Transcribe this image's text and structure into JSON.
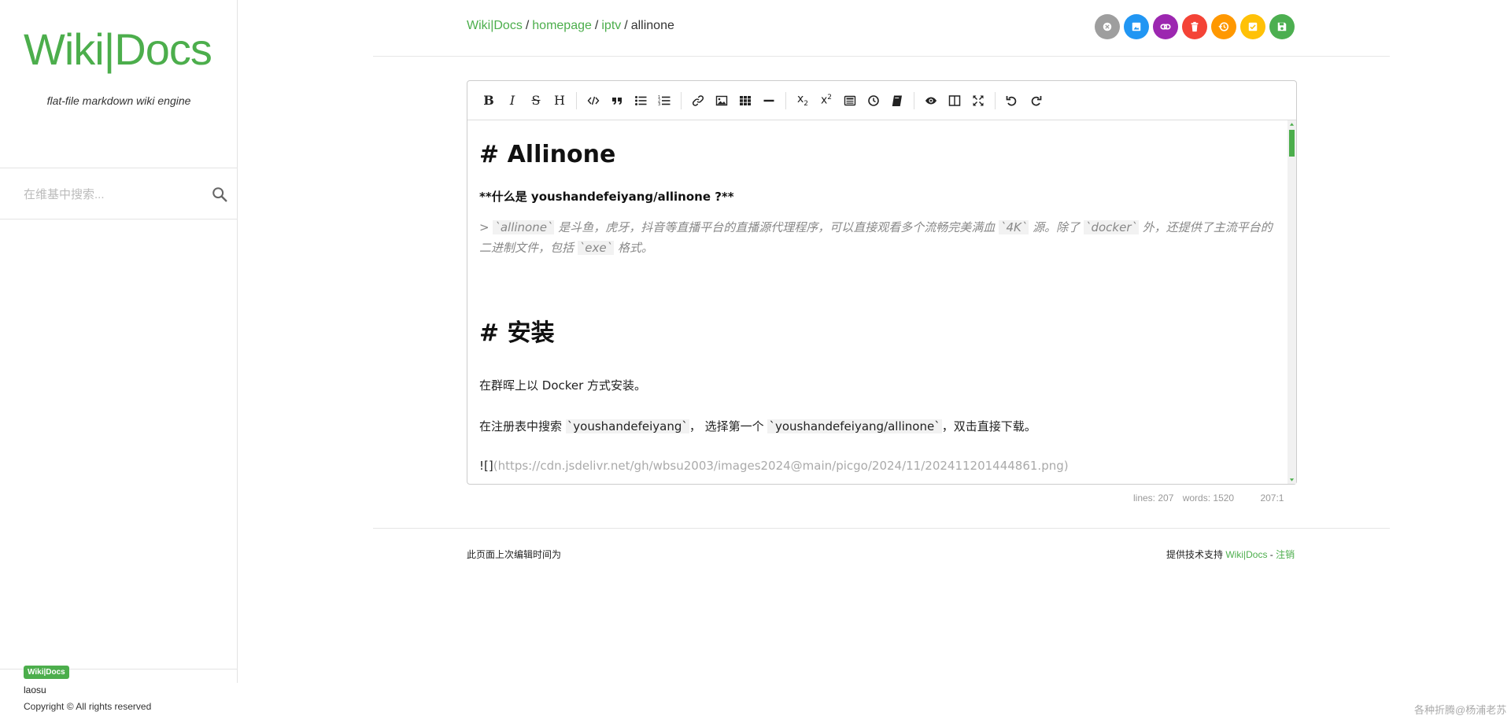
{
  "sidebar": {
    "logo": "Wiki|Docs",
    "tagline": "flat-file markdown wiki engine",
    "search_placeholder": "在维基中搜索...",
    "badge": "Wiki|Docs",
    "user": "laosu",
    "copyright": "Copyright © All rights reserved"
  },
  "breadcrumb": {
    "items": [
      "Wiki|Docs",
      "homepage",
      "iptv"
    ],
    "separator": "/",
    "current": "allinone"
  },
  "actions": [
    {
      "name": "close",
      "color": "#9e9e9e",
      "icon": "close-icon"
    },
    {
      "name": "image",
      "color": "#2196f3",
      "icon": "image-icon"
    },
    {
      "name": "link",
      "color": "#9c27b0",
      "icon": "link-icon"
    },
    {
      "name": "delete",
      "color": "#f44336",
      "icon": "trash-icon"
    },
    {
      "name": "history",
      "color": "#ff9800",
      "icon": "history-icon"
    },
    {
      "name": "checklist",
      "color": "#ffc107",
      "icon": "check-square-icon"
    },
    {
      "name": "save",
      "color": "#4caf50",
      "icon": "save-icon"
    }
  ],
  "editor": {
    "h1_a": "# Allinone",
    "bold_line": "**什么是 youshandefeiyang/allinone ?**",
    "quote": {
      "p1": "> ",
      "c1": "`allinone`",
      "p2": " 是斗鱼，虎牙，抖音等直播平台的直播源代理程序，可以直接观看多个流畅完美满血 ",
      "c2": "`4K`",
      "p3": " 源。除了 ",
      "c3": "`docker`",
      "p4": " 外，还提供了主流平台的二进制文件，包括 ",
      "c4": "`exe`",
      "p5": " 格式。"
    },
    "h1_b": "# 安装",
    "line1": "在群晖上以 Docker 方式安装。",
    "line2": {
      "p1": "在注册表中搜索 ",
      "c1": "`youshandefeiyang`",
      "p2": "， 选择第一个 ",
      "c2": "`youshandefeiyang/allinone`",
      "p3": "，双击直接下载。"
    },
    "img_line": {
      "bang": "![]",
      "url": "(https://cdn.jsdelivr.net/gh/wbsu2003/images2024@main/picgo/2024/11/202411201444861.png)"
    }
  },
  "status": {
    "lines": "lines: 207",
    "words": "words: 1520",
    "cursor": "207:1"
  },
  "footer": {
    "left": "此页面上次编辑时间为",
    "right_prefix": "提供技术支持 ",
    "right_brand": "Wiki|Docs",
    "right_sep": " - ",
    "right_logout": "注销"
  },
  "watermark": "各种折腾@杨浦老苏",
  "colors": {
    "accent": "#4cae4c"
  }
}
